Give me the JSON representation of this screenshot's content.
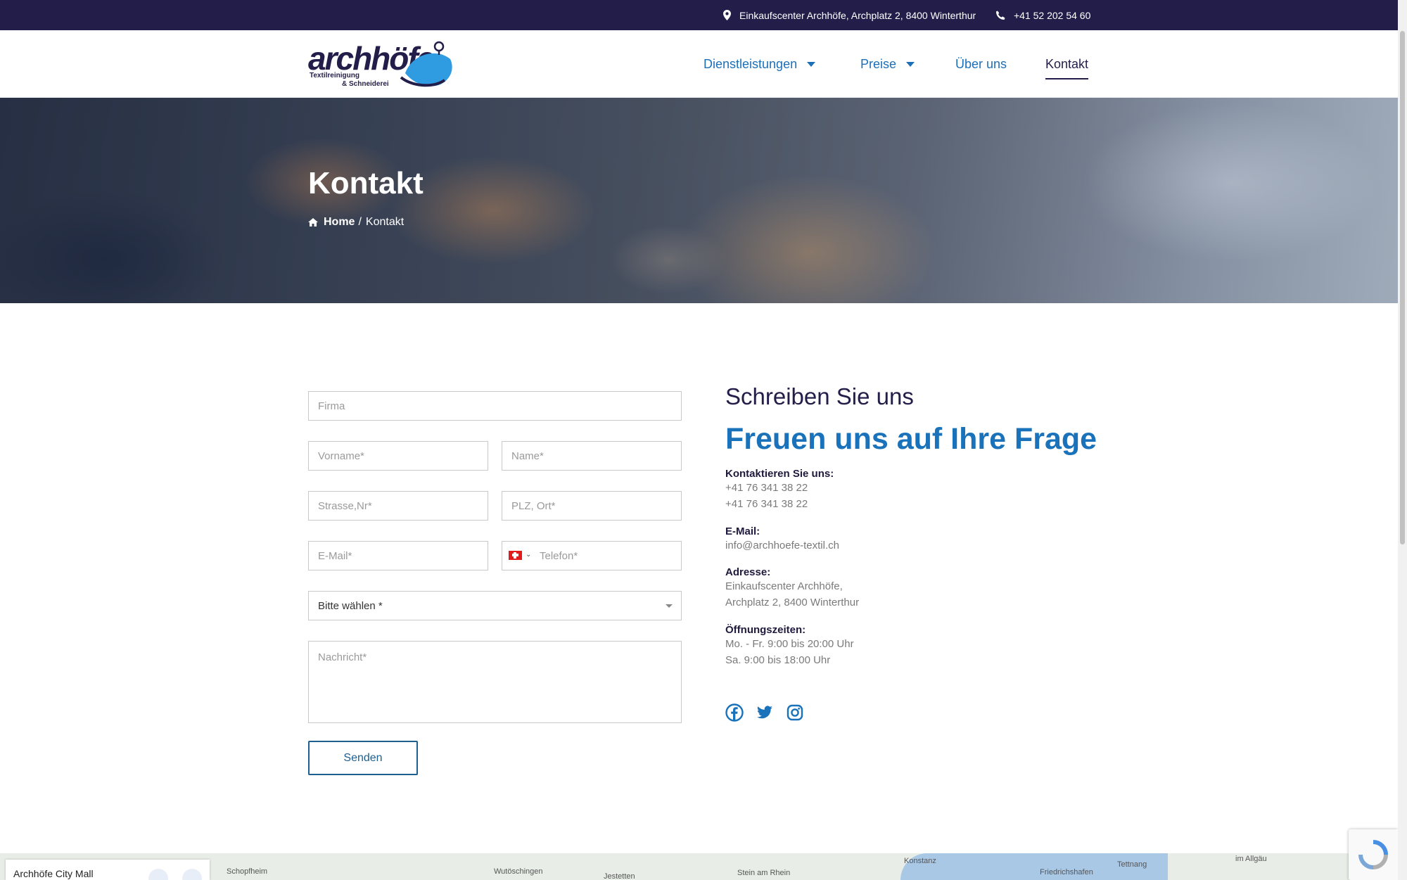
{
  "topbar": {
    "address": "Einkaufscenter Archhöfe, Archplatz 2, 8400 Winterthur",
    "phone": "+41 52 202 54 60"
  },
  "header": {
    "logo": {
      "wordmark": "archhöfe",
      "tagline_1": "Textilreinigung",
      "tagline_2": "& Schneiderei"
    },
    "nav": [
      {
        "label": "Dienstleistungen",
        "has_dropdown": true
      },
      {
        "label": "Preise",
        "has_dropdown": true
      },
      {
        "label": "Über uns",
        "has_dropdown": false
      },
      {
        "label": "Kontakt",
        "has_dropdown": false,
        "active": true
      }
    ]
  },
  "hero": {
    "title": "Kontakt",
    "breadcrumb": {
      "home": "Home",
      "separator": "/",
      "current": "Kontakt"
    }
  },
  "form": {
    "firma": "Firma",
    "vorname": "Vorname*",
    "name": "Name*",
    "strasse": "Strasse,Nr*",
    "plz_ort": "PLZ, Ort*",
    "email": "E-Mail*",
    "telefon": "Telefon*",
    "select_value": "Bitte wählen *",
    "nachricht": "Nachricht*",
    "submit": "Senden",
    "phone_country_icon": "swiss-flag-icon"
  },
  "contact": {
    "heading": "Schreiben Sie uns",
    "subheading": "Freuen uns auf Ihre Frage",
    "phone_label": "Kontaktieren Sie uns:",
    "phone_1": "+41 76 341 38 22",
    "phone_2": "+41 76 341 38 22",
    "email_label": "E-Mail:",
    "email": "info@archhoefe-textil.ch",
    "address_label": "Adresse:",
    "address_1": "Einkaufscenter Archhöfe,",
    "address_2": "Archplatz 2, 8400 Winterthur",
    "hours_label": "Öffnungszeiten:",
    "hours_1": "Mo. - Fr. 9:00 bis 20:00 Uhr",
    "hours_2": "Sa. 9:00 bis 18:00 Uhr",
    "social": [
      "facebook-icon",
      "twitter-icon",
      "instagram-icon"
    ]
  },
  "map": {
    "card_title": "Archhöfe City Mall",
    "places": [
      "Schopfheim",
      "Wutöschingen",
      "Jestetten",
      "Stein am Rhein",
      "Konstanz",
      "Friedrichshafen",
      "Tettnang",
      "im Allgäu"
    ]
  },
  "colors": {
    "topbar_bg": "#231d4a",
    "nav_link": "#1d6fb8",
    "accent_heading": "#1a73ba",
    "button_border": "#1d5f8f"
  }
}
